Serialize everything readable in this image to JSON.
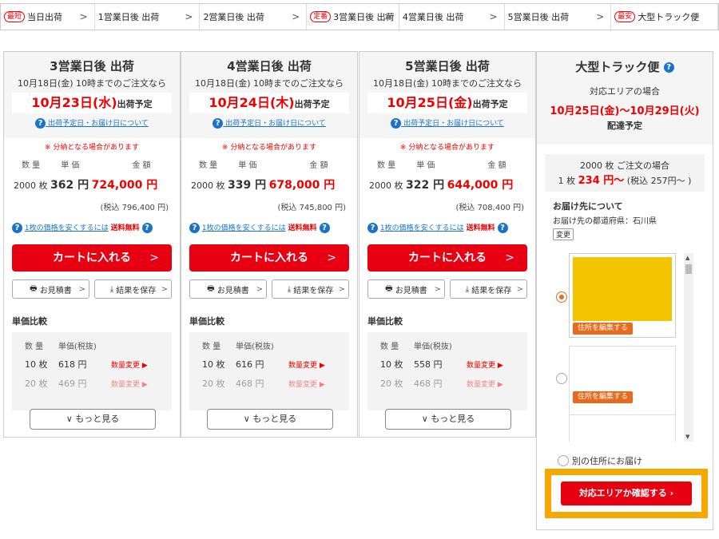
{
  "tabs": [
    {
      "badge": "最短",
      "label": "当日出荷",
      "w": 118
    },
    {
      "badge": "",
      "label": "1営業日後 出荷",
      "w": 132
    },
    {
      "badge": "",
      "label": "2営業日後 出荷",
      "w": 134
    },
    {
      "badge": "定番",
      "label": "3営業日後 出荷",
      "w": 116
    },
    {
      "badge": "",
      "label": "4営業日後 出荷",
      "w": 132
    },
    {
      "badge": "",
      "label": "5営業日後 出荷",
      "w": 134
    },
    {
      "badge": "最安",
      "label": "大型トラック便",
      "w": 134
    }
  ],
  "tab_chevron": ">",
  "cards": [
    {
      "title": "3営業日後 出荷",
      "cutoff": "10月18日(金) 10時までのご注文なら",
      "date": "10月23日(水)",
      "ship": "出荷予定",
      "qty": "2000 枚",
      "unit": "362 円",
      "total": "724,000 円",
      "tax": "(税込 796,400 円)",
      "rows": [
        {
          "q": "10 枚",
          "p": "618 円"
        },
        {
          "q": "20 枚",
          "p": "469 円"
        }
      ]
    },
    {
      "title": "4営業日後 出荷",
      "cutoff": "10月18日(金) 10時までのご注文なら",
      "date": "10月24日(木)",
      "ship": "出荷予定",
      "qty": "2000 枚",
      "unit": "339 円",
      "total": "678,000 円",
      "tax": "(税込 745,800 円)",
      "rows": [
        {
          "q": "10 枚",
          "p": "616 円"
        },
        {
          "q": "20 枚",
          "p": "468 円"
        }
      ]
    },
    {
      "title": "5営業日後 出荷",
      "cutoff": "10月18日(金) 10時までのご注文なら",
      "date": "10月25日(金)",
      "ship": "出荷予定",
      "qty": "2000 枚",
      "unit": "322 円",
      "total": "644,000 円",
      "tax": "(税込 708,400 円)",
      "rows": [
        {
          "q": "10 枚",
          "p": "558 円"
        },
        {
          "q": "20 枚",
          "p": "468 円"
        }
      ]
    }
  ],
  "common": {
    "about": "出荷予定日・お届け日について",
    "note": "※ 分納となる場合があります",
    "h_qty": "数 量",
    "h_unit": "単 価",
    "h_total": "金 額",
    "cheap_link": "1枚の価格を安くするには",
    "free": "送料無料",
    "cart": "カートに入れる",
    "cart_arrow": ">",
    "quote": "お見積書",
    "save": "結果を保存",
    "compare": "単価比較",
    "c_qty": "数 量",
    "c_unit": "単価(税抜)",
    "change": "数量変更 ▶",
    "more": "∨ もっと見る"
  },
  "truck": {
    "title": "大型トラック便",
    "area": "対応エリアの場合",
    "range": "10月25日(金)〜10月29日(火)",
    "deliv": "配達予定",
    "order_line1": "2000 枚 ご注文の場合",
    "order_pre": "1 枚",
    "order_price": "234 円〜",
    "order_tax": "(税込 257円〜 )",
    "dest_title": "お届け先について",
    "dest_pref": "お届け先の都道府県：石川県",
    "dest_change": "変更",
    "edit": "住所を編集する",
    "other": "別の住所にお届け",
    "confirm": "対応エリアか確認する"
  },
  "colors": {
    "accent": "#e60012",
    "highlight": "#f5a800",
    "link": "#1a73c8",
    "address_fill": "#f5c400",
    "edit_button": "#e86a1c"
  }
}
